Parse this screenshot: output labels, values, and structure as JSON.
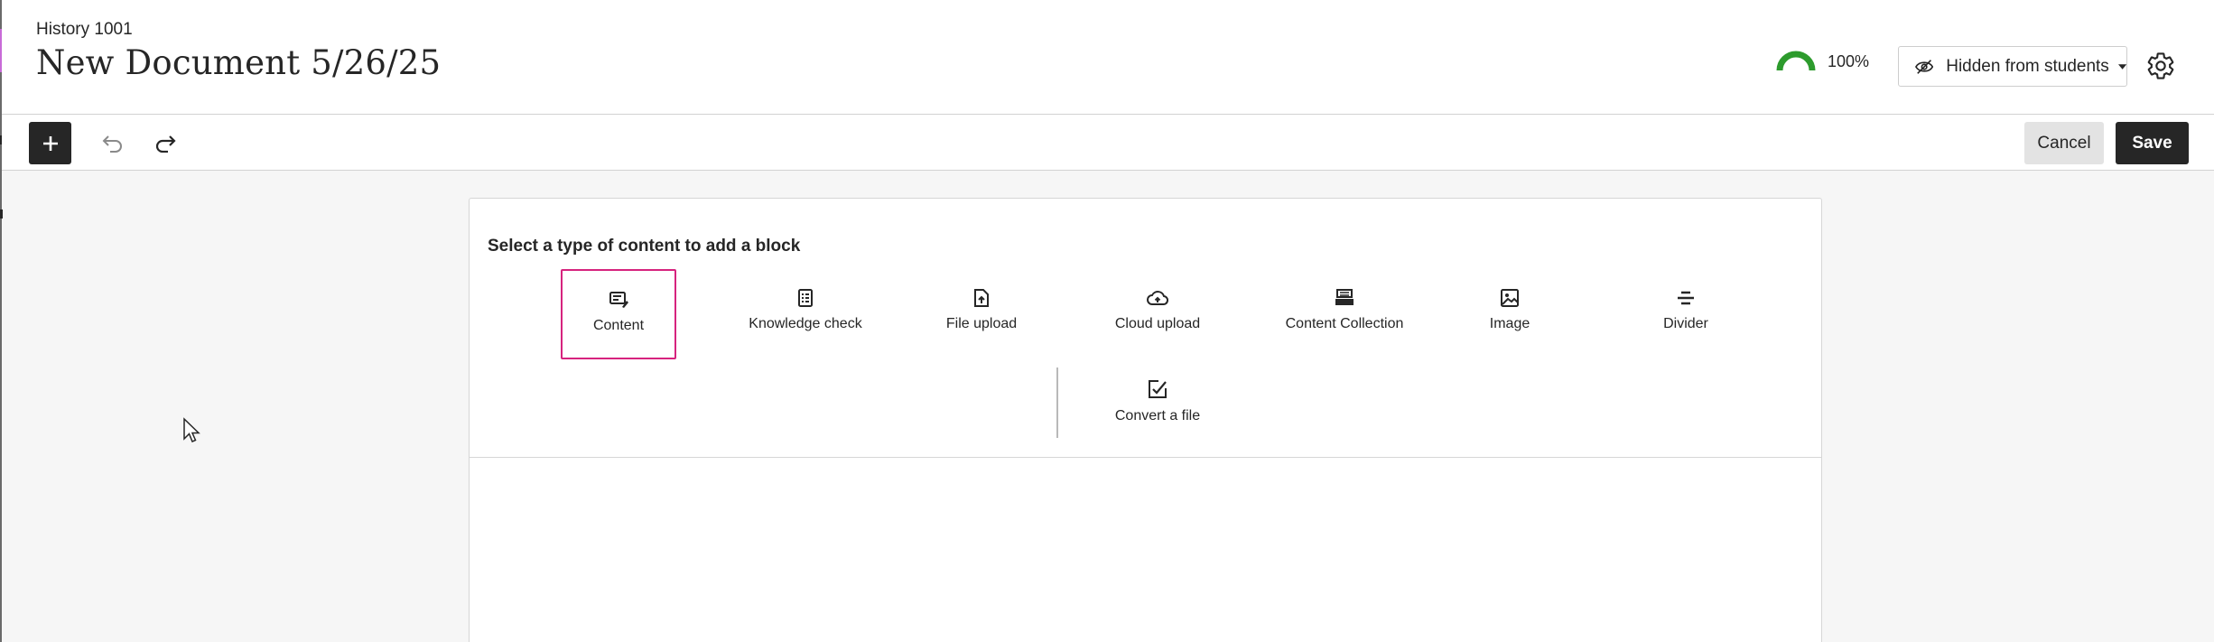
{
  "header": {
    "course_name": "History 1001",
    "document_title": "New Document 5/26/25",
    "progress_label": "100%",
    "visibility_label": "Hidden from students"
  },
  "toolbar": {
    "cancel_label": "Cancel",
    "save_label": "Save"
  },
  "content_picker": {
    "heading": "Select a type of content to add a block",
    "options": [
      {
        "label": "Content",
        "icon": "content-block-icon",
        "selected": true
      },
      {
        "label": "Knowledge check",
        "icon": "knowledge-check-icon"
      },
      {
        "label": "File upload",
        "icon": "file-upload-icon"
      },
      {
        "label": "Cloud upload",
        "icon": "cloud-upload-icon"
      },
      {
        "label": "Content Collection",
        "icon": "content-collection-icon"
      },
      {
        "label": "Image",
        "icon": "image-icon"
      },
      {
        "label": "Divider",
        "icon": "divider-icon"
      },
      {
        "label": "Convert a file",
        "icon": "convert-file-icon"
      }
    ]
  },
  "colors": {
    "accent_tab": "#c86bd8",
    "selection_border": "#d6237e",
    "progress_green": "#2d9b2d",
    "primary_button": "#262626"
  }
}
